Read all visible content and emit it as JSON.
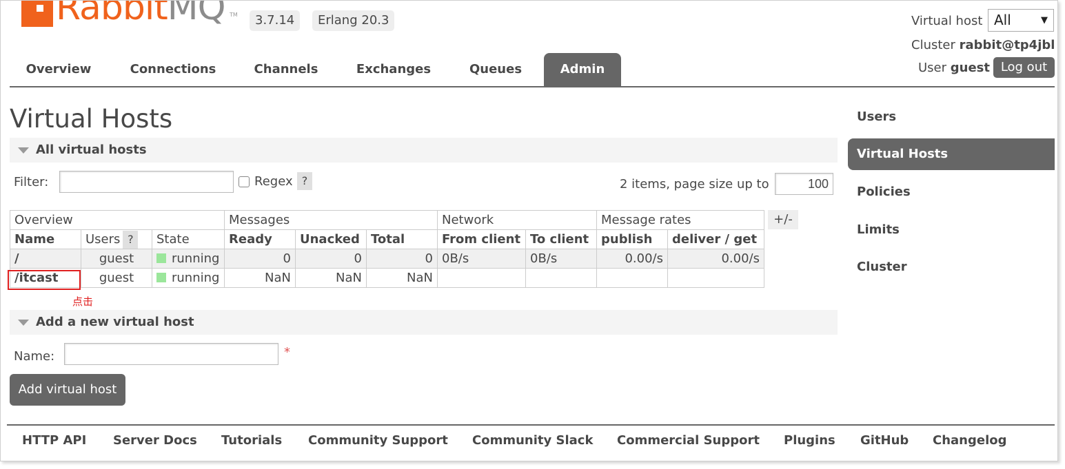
{
  "header": {
    "logo_text_orange": "Rabbit",
    "logo_text_grey": "MQ",
    "logo_tm": "TM",
    "version": "3.7.14",
    "erlang": "Erlang 20.3",
    "virtual_host_label": "Virtual host",
    "virtual_host_value": "All",
    "cluster_label": "Cluster",
    "cluster_value": "rabbit@tp4jbl",
    "user_label": "User",
    "user_value": "guest",
    "logout_label": "Log out"
  },
  "tabs": [
    {
      "label": "Overview",
      "active": false
    },
    {
      "label": "Connections",
      "active": false
    },
    {
      "label": "Channels",
      "active": false
    },
    {
      "label": "Exchanges",
      "active": false
    },
    {
      "label": "Queues",
      "active": false
    },
    {
      "label": "Admin",
      "active": true
    }
  ],
  "main": {
    "title": "Virtual Hosts",
    "all_section": "All virtual hosts",
    "filter_label": "Filter:",
    "filter_value": "",
    "regex_label": "Regex",
    "help": "?",
    "items_text": "2 items, page size up to",
    "page_size": "100",
    "plusminus": "+/-",
    "table": {
      "groups": [
        "Overview",
        "Messages",
        "Network",
        "Message rates"
      ],
      "columns": [
        "Name",
        "Users",
        "State",
        "Ready",
        "Unacked",
        "Total",
        "From client",
        "To client",
        "publish",
        "deliver / get"
      ],
      "rows": [
        {
          "name": "/",
          "users": "guest",
          "state": "running",
          "ready": "0",
          "unacked": "0",
          "total": "0",
          "from_client": "0B/s",
          "to_client": "0B/s",
          "publish": "0.00/s",
          "deliver_get": "0.00/s"
        },
        {
          "name": "/itcast",
          "users": "guest",
          "state": "running",
          "ready": "NaN",
          "unacked": "NaN",
          "total": "NaN",
          "from_client": "",
          "to_client": "",
          "publish": "",
          "deliver_get": ""
        }
      ]
    },
    "annotation": "点击",
    "add_section": "Add a new virtual host",
    "name_label": "Name:",
    "name_value": "",
    "required_mark": "*",
    "add_button": "Add virtual host"
  },
  "sidebar": {
    "items": [
      {
        "label": "Users",
        "active": false
      },
      {
        "label": "Virtual Hosts",
        "active": true
      },
      {
        "label": "Policies",
        "active": false
      },
      {
        "label": "Limits",
        "active": false
      },
      {
        "label": "Cluster",
        "active": false
      }
    ]
  },
  "footer": {
    "links": [
      "HTTP API",
      "Server Docs",
      "Tutorials",
      "Community Support",
      "Community Slack",
      "Commercial Support",
      "Plugins",
      "GitHub",
      "Changelog"
    ]
  },
  "colors": {
    "brand_orange": "#f0621c",
    "active_tab": "#666666",
    "running_green": "#9be69b",
    "annotation_red": "#e02020"
  }
}
